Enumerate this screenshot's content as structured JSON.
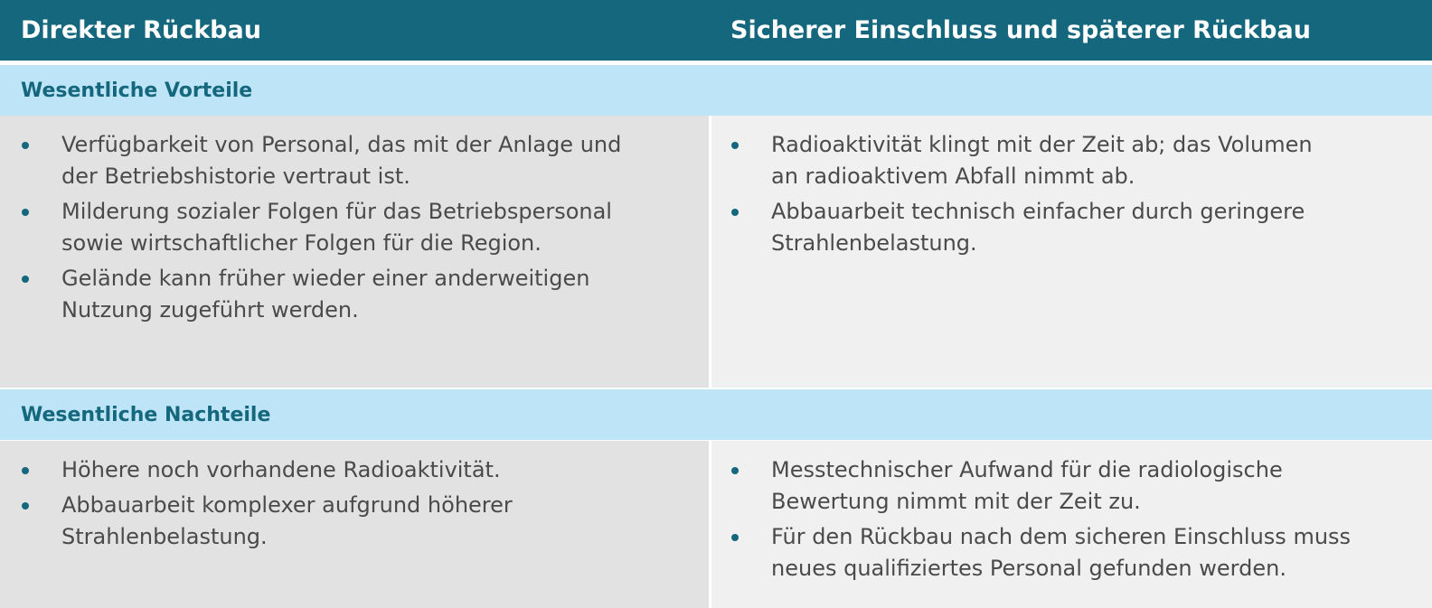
{
  "header": {
    "col1": "Direkter Rückbau",
    "col2": "Sicherer Einschluss und späterer Rückbau"
  },
  "advantages": {
    "title": "Wesentliche Vorteile",
    "left": [
      [
        "Verfügbarkeit von Personal, das mit der Anlage und",
        "der Betriebshistorie vertraut ist."
      ],
      [
        "Milderung sozialer Folgen für das Betriebspersonal",
        "sowie wirtschaftlicher Folgen für die Region."
      ],
      [
        "Gelände kann früher wieder einer anderweitigen",
        "Nutzung zugeführt werden."
      ]
    ],
    "right": [
      [
        "Radioaktivität klingt mit der Zeit ab; das Volumen",
        "an radioaktivem Abfall nimmt ab."
      ],
      [
        "Abbauarbeit technisch einfacher durch geringere",
        "Strahlenbelastung."
      ]
    ]
  },
  "disadvantages": {
    "title": "Wesentliche Nachteile",
    "left": [
      [
        "Höhere noch vorhandene Radioaktivität."
      ],
      [
        "Abbauarbeit komplexer aufgrund höherer",
        "Strahlenbelastung."
      ]
    ],
    "right": [
      [
        "Messtechnischer Aufwand für die radiologische",
        "Bewertung nimmt mit der Zeit zu."
      ],
      [
        "Für den Rückbau nach dem sicheren Einschluss muss",
        "neues qualifiziertes Personal gefunden werden."
      ]
    ]
  },
  "colors": {
    "header_bg": "#14677c",
    "section_bg": "#bee5f7",
    "left_cell_bg": "#e2e2e3",
    "right_cell_bg": "#f0f0f1",
    "bullet": "#14677c",
    "body_text": "#4a4a4a"
  }
}
